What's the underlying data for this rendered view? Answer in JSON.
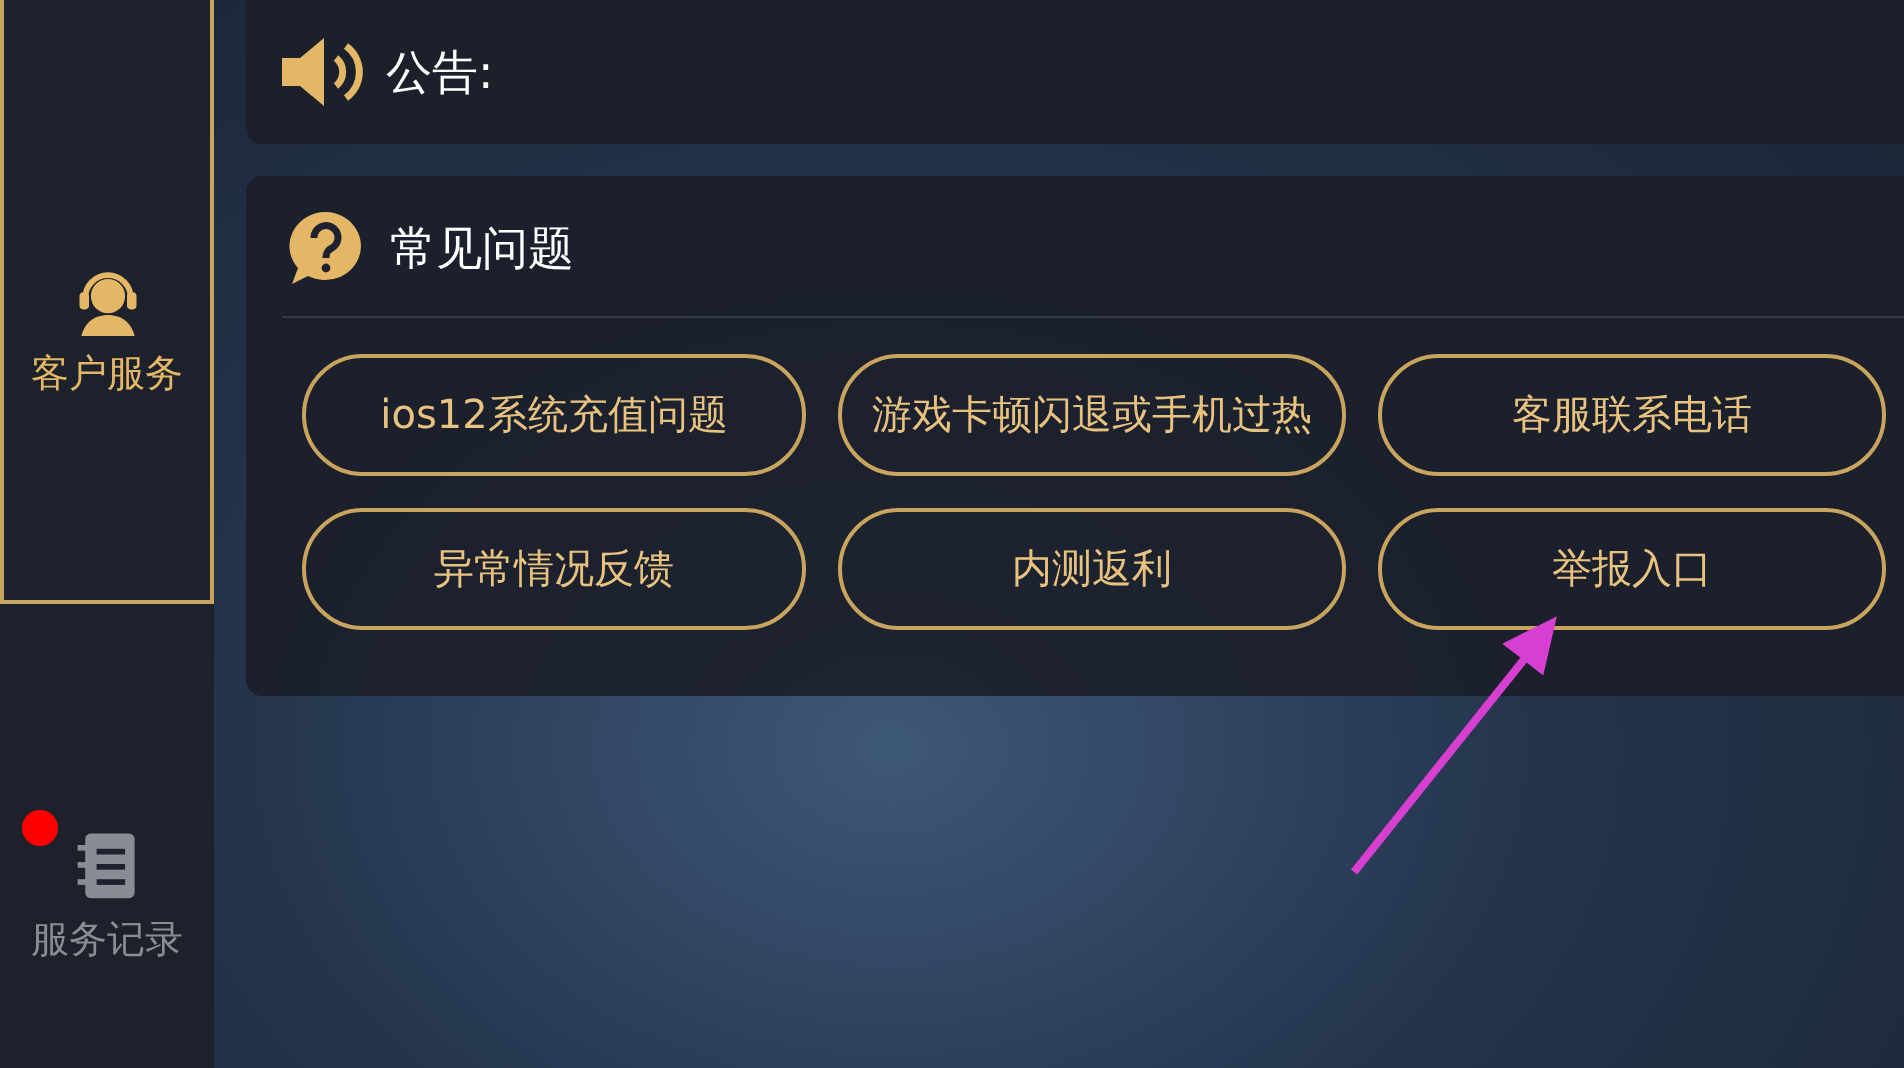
{
  "sidebar": {
    "items": [
      {
        "label": "客户服务",
        "kind": "service",
        "selected": true,
        "unread": false
      },
      {
        "label": "服务记录",
        "kind": "records",
        "selected": false,
        "unread": true
      }
    ]
  },
  "announcement": {
    "label": "公告:"
  },
  "faq": {
    "title": "常见问题",
    "buttons": [
      {
        "label": "ios12系统充值问题"
      },
      {
        "label": "游戏卡顿闪退或手机过热"
      },
      {
        "label": "客服联系电话"
      },
      {
        "label": "异常情况反馈"
      },
      {
        "label": "内测返利"
      },
      {
        "label": "举报入口"
      }
    ]
  },
  "annotation": {
    "kind": "arrow",
    "color": "#d63fd0"
  }
}
